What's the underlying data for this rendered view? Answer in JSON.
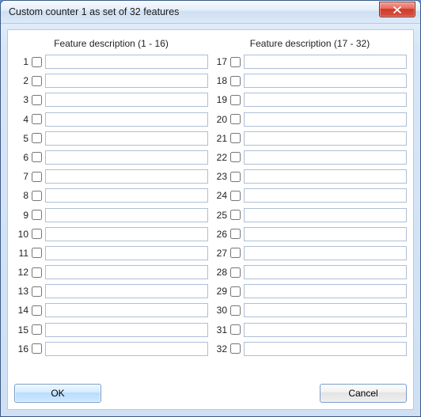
{
  "window": {
    "title": "Custom counter 1 as set of 32 features"
  },
  "columns": {
    "left_header": "Feature description (1 - 16)",
    "right_header": "Feature description (17 - 32)"
  },
  "features": [
    {
      "n": 1,
      "checked": false,
      "value": ""
    },
    {
      "n": 2,
      "checked": false,
      "value": ""
    },
    {
      "n": 3,
      "checked": false,
      "value": ""
    },
    {
      "n": 4,
      "checked": false,
      "value": ""
    },
    {
      "n": 5,
      "checked": false,
      "value": ""
    },
    {
      "n": 6,
      "checked": false,
      "value": ""
    },
    {
      "n": 7,
      "checked": false,
      "value": ""
    },
    {
      "n": 8,
      "checked": false,
      "value": ""
    },
    {
      "n": 9,
      "checked": false,
      "value": ""
    },
    {
      "n": 10,
      "checked": false,
      "value": ""
    },
    {
      "n": 11,
      "checked": false,
      "value": ""
    },
    {
      "n": 12,
      "checked": false,
      "value": ""
    },
    {
      "n": 13,
      "checked": false,
      "value": ""
    },
    {
      "n": 14,
      "checked": false,
      "value": ""
    },
    {
      "n": 15,
      "checked": false,
      "value": ""
    },
    {
      "n": 16,
      "checked": false,
      "value": ""
    },
    {
      "n": 17,
      "checked": false,
      "value": ""
    },
    {
      "n": 18,
      "checked": false,
      "value": ""
    },
    {
      "n": 19,
      "checked": false,
      "value": ""
    },
    {
      "n": 20,
      "checked": false,
      "value": ""
    },
    {
      "n": 21,
      "checked": false,
      "value": ""
    },
    {
      "n": 22,
      "checked": false,
      "value": ""
    },
    {
      "n": 23,
      "checked": false,
      "value": ""
    },
    {
      "n": 24,
      "checked": false,
      "value": ""
    },
    {
      "n": 25,
      "checked": false,
      "value": ""
    },
    {
      "n": 26,
      "checked": false,
      "value": ""
    },
    {
      "n": 27,
      "checked": false,
      "value": ""
    },
    {
      "n": 28,
      "checked": false,
      "value": ""
    },
    {
      "n": 29,
      "checked": false,
      "value": ""
    },
    {
      "n": 30,
      "checked": false,
      "value": ""
    },
    {
      "n": 31,
      "checked": false,
      "value": ""
    },
    {
      "n": 32,
      "checked": false,
      "value": ""
    }
  ],
  "buttons": {
    "ok": "OK",
    "cancel": "Cancel"
  }
}
